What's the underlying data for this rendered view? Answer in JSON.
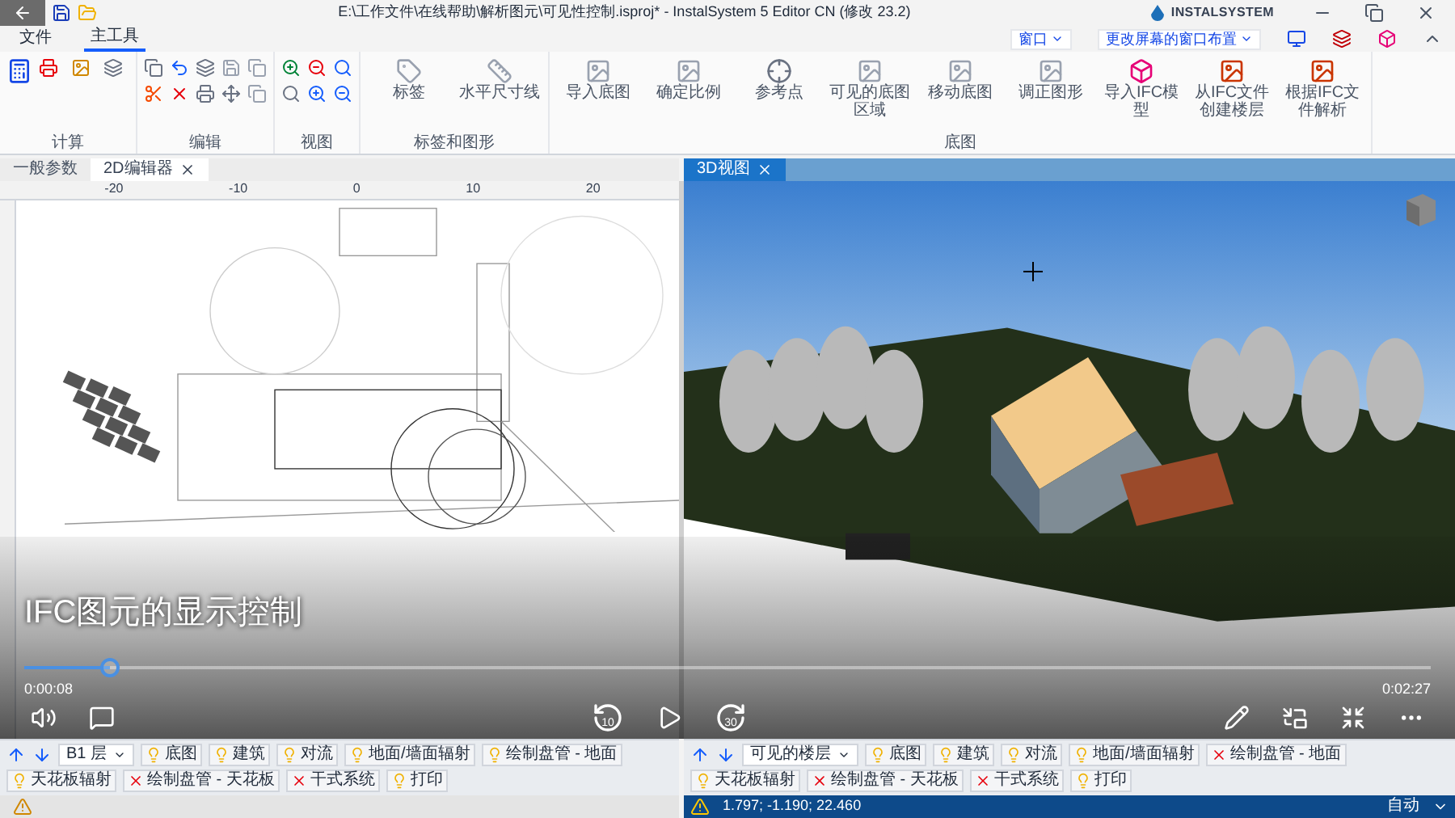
{
  "window": {
    "title": "E:\\工作文件\\在线帮助\\解析图元\\可见性控制.isproj* - InstalSystem 5 Editor CN (修改 23.2)",
    "logo": "INSTALSYSTEM"
  },
  "ribbon_tabs": [
    {
      "label": "文件",
      "selected": false
    },
    {
      "label": "主工具",
      "selected": true
    }
  ],
  "window_menu": [
    "窗口",
    "更改屏幕的窗口布置"
  ],
  "ribbon_groups": [
    {
      "label": "计算"
    },
    {
      "label": "编辑"
    },
    {
      "label": "视图"
    },
    {
      "label": "标签和图形",
      "buttons": [
        "标签",
        "水平尺寸线"
      ]
    },
    {
      "label": "底图",
      "buttons": [
        "导入底图",
        "确定比例",
        "参考点",
        "可见的底图区域",
        "移动底图",
        "调正图形",
        "导入IFC模型",
        "从IFC文件创建楼层",
        "根据IFC文件解析"
      ]
    }
  ],
  "doc_tabs_left": [
    {
      "label": "一般参数",
      "selected": false,
      "closable": false
    },
    {
      "label": "2D编辑器",
      "selected": true,
      "closable": true
    }
  ],
  "doc_tabs_right": [
    {
      "label": "3D视图",
      "selected": true,
      "closable": true
    }
  ],
  "ruler": {
    "labels": [
      "-20",
      "-10",
      "0",
      "10",
      "20"
    ]
  },
  "video": {
    "title": "IFC图元的显示控制",
    "elapsed": "0:00:08",
    "duration": "0:02:27",
    "level": 0.061,
    "rewind": "10",
    "forward": "30"
  },
  "layer_bar_left": {
    "floor": "B1 层",
    "items": [
      {
        "label": "底图",
        "visible": true
      },
      {
        "label": "建筑",
        "visible": true
      },
      {
        "label": "对流",
        "visible": true
      },
      {
        "label": "地面/墙面辐射",
        "visible": true
      },
      {
        "label": "绘制盘管 - 地面",
        "visible": true
      },
      {
        "label": "天花板辐射",
        "visible": true
      },
      {
        "label": "绘制盘管 - 天花板",
        "visible": false
      },
      {
        "label": "干式系统",
        "visible": false
      },
      {
        "label": "打印",
        "visible": true
      }
    ]
  },
  "layer_bar_right": {
    "floor": "可见的楼层",
    "items": [
      {
        "label": "底图",
        "visible": true
      },
      {
        "label": "建筑",
        "visible": true
      },
      {
        "label": "对流",
        "visible": true
      },
      {
        "label": "地面/墙面辐射",
        "visible": true
      },
      {
        "label": "绘制盘管 - 地面",
        "visible": false
      },
      {
        "label": "天花板辐射",
        "visible": true
      },
      {
        "label": "绘制盘管 - 天花板",
        "visible": false
      },
      {
        "label": "干式系统",
        "visible": false
      },
      {
        "label": "打印",
        "visible": true
      }
    ]
  },
  "status_right": {
    "coords": "1.797; -1.190; 22.460",
    "modes": [
      "自动"
    ]
  }
}
